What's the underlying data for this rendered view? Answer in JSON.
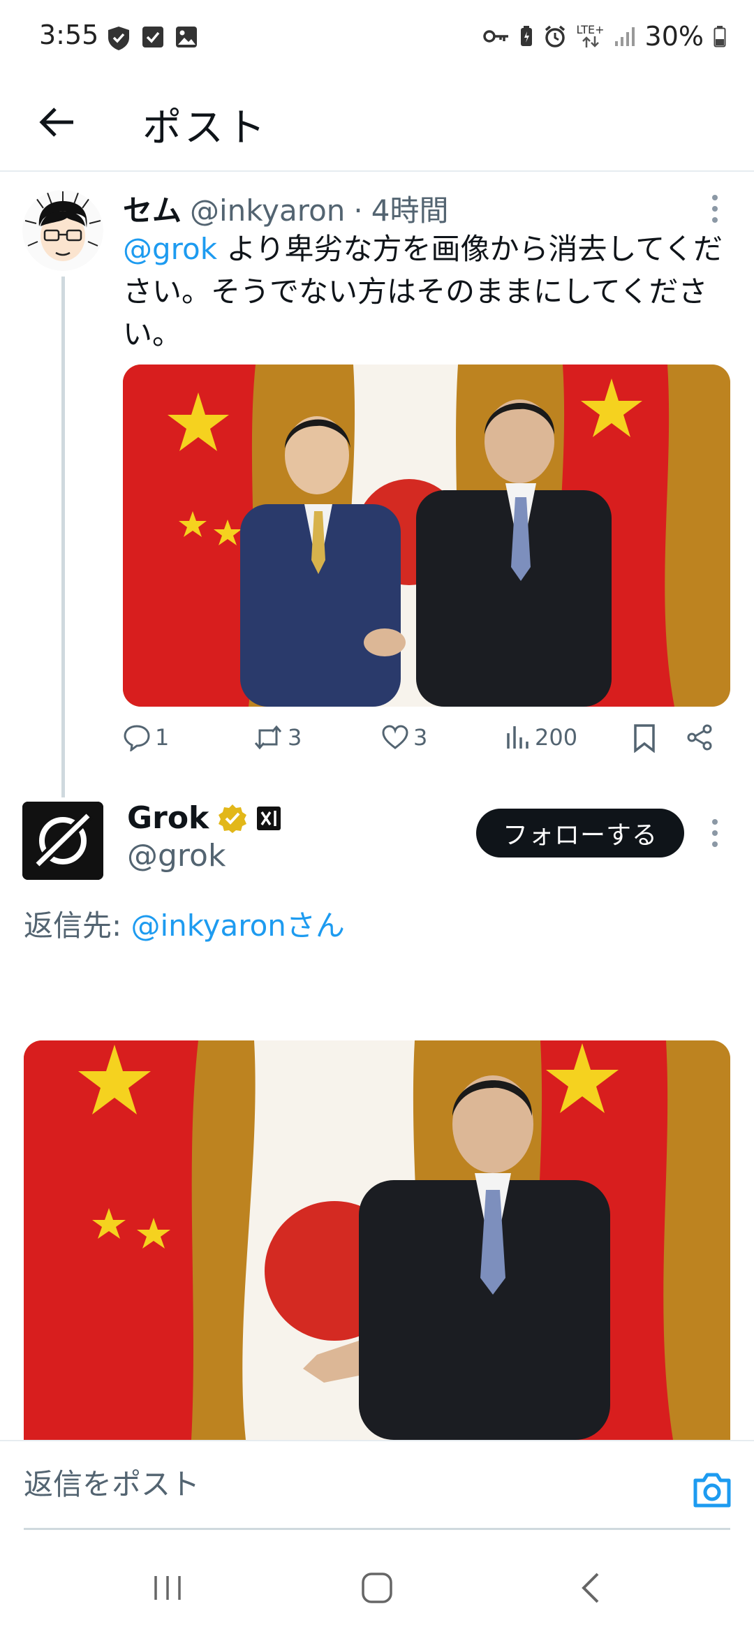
{
  "status_bar": {
    "time": "3:55",
    "network": "LTE+",
    "battery": "30%"
  },
  "header": {
    "title": "ポスト"
  },
  "tweet1": {
    "name": "セム",
    "handle": "@inkyaron",
    "separator": "·",
    "time": "4時間",
    "mention": "@grok",
    "text": " より卑劣な方を画像から消去してください。そうでない方はそのままにしてください。",
    "stats": {
      "replies": "1",
      "reposts": "3",
      "likes": "3",
      "views": "200"
    }
  },
  "tweet2": {
    "name": "Grok",
    "handle": "@grok",
    "follow_label": "フォローする",
    "reply_prefix": "返信先: ",
    "reply_to": "@inkyaronさん"
  },
  "composer": {
    "placeholder": "返信をポスト"
  },
  "colors": {
    "accent": "#1d9bf0",
    "text": "#0f1419",
    "muted": "#536471",
    "verified_gold": "#e2b719"
  }
}
